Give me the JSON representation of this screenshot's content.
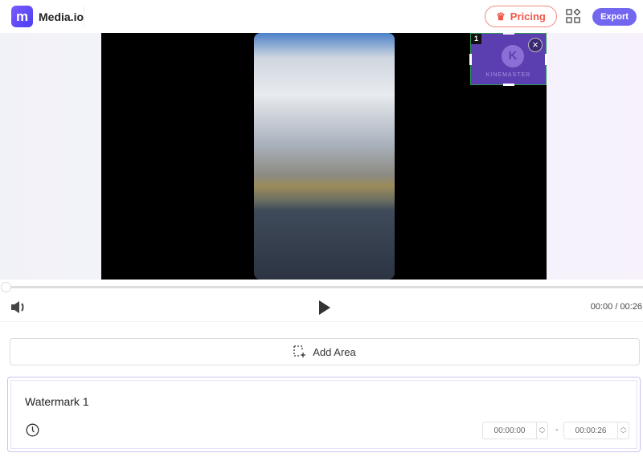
{
  "header": {
    "logo_letter": "m",
    "brand": "Media.io",
    "pricing_label": "Pricing",
    "export_label": "Export"
  },
  "colors": {
    "accent": "#7367f0",
    "pricing": "#f0574a",
    "watermark": "#5b3fb0"
  },
  "watermark_overlay": {
    "index": "1",
    "logo_letter": "K",
    "text": "KINEMASTER"
  },
  "player": {
    "time": "00:00 / 00:26",
    "progress_percent": 0
  },
  "add_area_label": "Add Area",
  "watermark_card": {
    "title": "Watermark 1",
    "start": "00:00:00",
    "end": "00:00:26",
    "separator": "-"
  }
}
